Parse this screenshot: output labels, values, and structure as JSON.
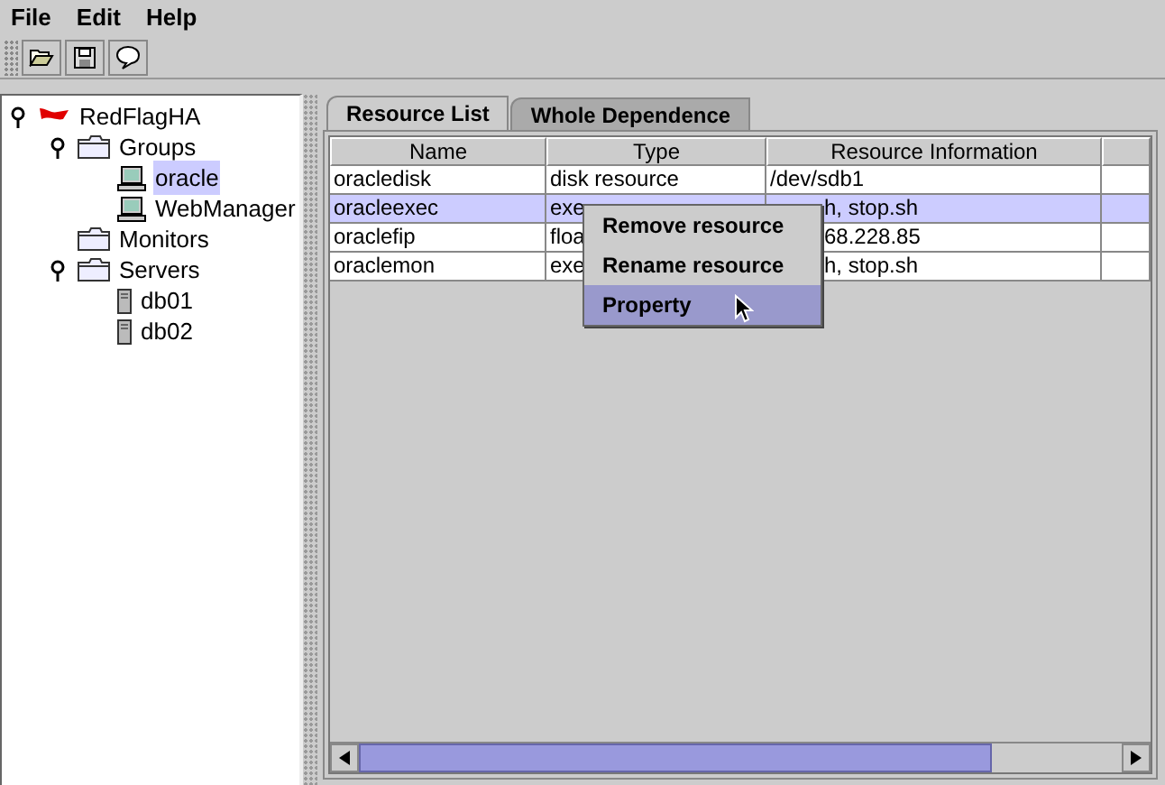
{
  "menu_bar": [
    "File",
    "Edit",
    "Help"
  ],
  "tree": [
    {
      "label": "RedFlagHA",
      "kind": "root",
      "expanded": true,
      "selected": false,
      "children": [
        {
          "label": "Groups",
          "kind": "folder",
          "expanded": true,
          "selected": false,
          "children": [
            {
              "label": "oracle",
              "kind": "computer",
              "selected": true
            },
            {
              "label": "WebManager",
              "kind": "computer",
              "selected": false
            }
          ]
        },
        {
          "label": "Monitors",
          "kind": "folder",
          "selected": false
        },
        {
          "label": "Servers",
          "kind": "folder",
          "expanded": true,
          "selected": false,
          "children": [
            {
              "label": "db01",
              "kind": "server",
              "selected": false
            },
            {
              "label": "db02",
              "kind": "server",
              "selected": false
            }
          ]
        }
      ]
    }
  ],
  "tabs": [
    {
      "label": "Resource List",
      "selected": true
    },
    {
      "label": "Whole Dependence",
      "selected": false
    }
  ],
  "table": {
    "columns": [
      "Name",
      "Type",
      "Resource Information"
    ],
    "rows": [
      {
        "cells": [
          "oracledisk",
          "disk resource",
          "/dev/sdb1"
        ],
        "selected": false
      },
      {
        "cells": [
          "oracleexec",
          "exe",
          "h, stop.sh"
        ],
        "selected": true
      },
      {
        "cells": [
          "oraclefip",
          "floa",
          "68.228.85"
        ],
        "selected": false
      },
      {
        "cells": [
          "oraclemon",
          "exe",
          "h, stop.sh"
        ],
        "selected": false
      }
    ]
  },
  "context_menu": [
    {
      "label": "Remove resource",
      "selected": false
    },
    {
      "label": "Rename resource",
      "selected": false
    },
    {
      "label": "Property",
      "selected": true
    }
  ]
}
